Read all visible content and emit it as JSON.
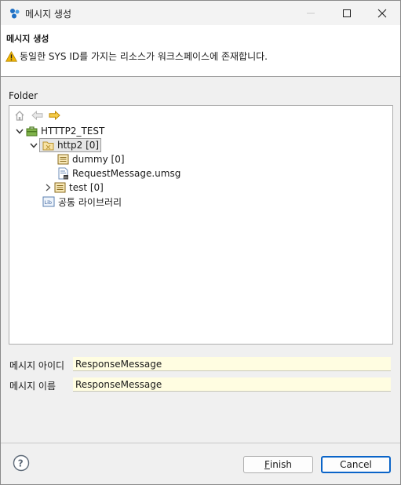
{
  "window": {
    "title": "메시지 생성"
  },
  "header": {
    "title": "메시지 생성",
    "warning": "동일한 SYS ID를 가지는 리소스가 워크스페이스에 존재합니다."
  },
  "folder": {
    "label": "Folder"
  },
  "tree": {
    "toolbar": [
      "home-icon",
      "back-icon",
      "forward-icon"
    ],
    "project": {
      "label": "HTTTP2_TEST",
      "expanded": true
    },
    "folder": {
      "label": "http2 [0]",
      "expanded": true,
      "selected": true
    },
    "children": [
      {
        "label": "dummy [0]",
        "icon": "message-folder-icon"
      },
      {
        "label": "RequestMessage.umsg",
        "icon": "message-file-icon"
      },
      {
        "label": "test [0]",
        "icon": "message-folder-icon",
        "expanded": false
      }
    ],
    "library": {
      "label": "공통 라이브러리"
    }
  },
  "form": {
    "id_label": "메시지 아이디",
    "id_value": "ResponseMessage",
    "name_label": "메시지 이름",
    "name_value": "ResponseMessage"
  },
  "buttons": {
    "finish_mnemonic": "F",
    "finish_rest": "inish",
    "cancel": "Cancel"
  },
  "colors": {
    "input_bg": "#fffde1",
    "default_button_border": "#0a64c8",
    "warning": "#f2b705"
  }
}
